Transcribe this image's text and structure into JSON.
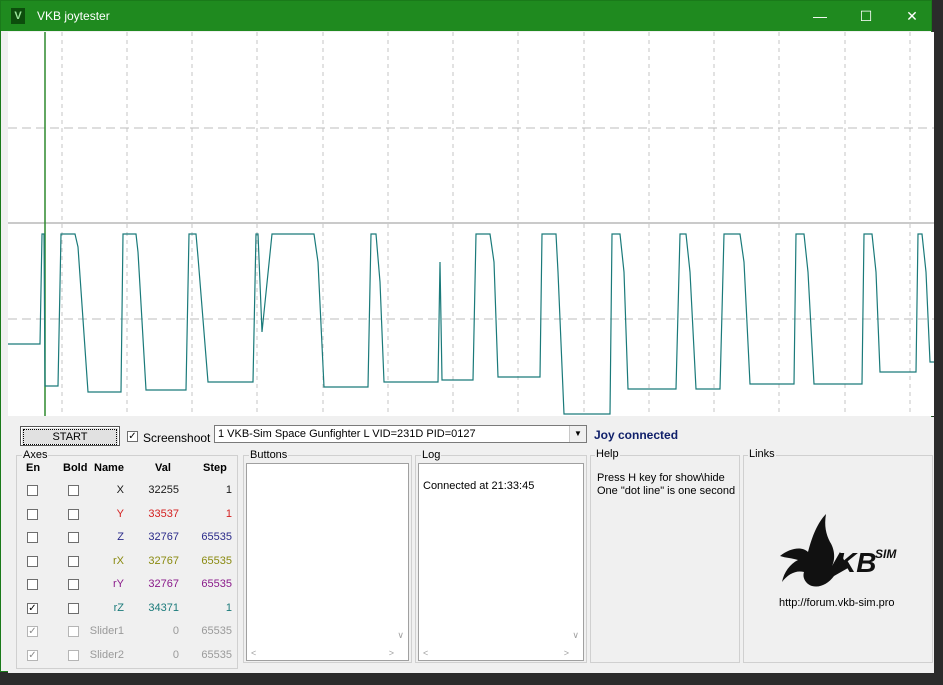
{
  "window": {
    "title": "VKB joytester",
    "minimize": "—",
    "maximize": "☐",
    "close": "✕"
  },
  "toolbar": {
    "start_label": "START",
    "screenshoot_label": "Screenshoot",
    "screenshoot_checked": true,
    "device_selected": "1  VKB-Sim Space Gunfighter L  VID=231D PID=0127",
    "status": "Joy connected"
  },
  "axes": {
    "title": "Axes",
    "headers": {
      "en": "En",
      "bold": "Bold",
      "name": "Name",
      "val": "Val",
      "step": "Step"
    },
    "rows": [
      {
        "name": "X",
        "val": "32255",
        "step": "1",
        "color": "#1a1a1a",
        "en": false,
        "bold": false,
        "disabled": false
      },
      {
        "name": "Y",
        "val": "33537",
        "step": "1",
        "color": "#d42020",
        "en": false,
        "bold": false,
        "disabled": false
      },
      {
        "name": "Z",
        "val": "32767",
        "step": "65535",
        "color": "#2a2a8a",
        "en": false,
        "bold": false,
        "disabled": false
      },
      {
        "name": "rX",
        "val": "32767",
        "step": "65535",
        "color": "#8a8a10",
        "en": false,
        "bold": false,
        "disabled": false
      },
      {
        "name": "rY",
        "val": "32767",
        "step": "65535",
        "color": "#8a1a8a",
        "en": false,
        "bold": false,
        "disabled": false
      },
      {
        "name": "rZ",
        "val": "34371",
        "step": "1",
        "color": "#1a7a7a",
        "en": true,
        "bold": false,
        "disabled": false
      },
      {
        "name": "Slider1",
        "val": "0",
        "step": "65535",
        "color": "#9a9a9a",
        "en": true,
        "bold": false,
        "disabled": true
      },
      {
        "name": "Slider2",
        "val": "0",
        "step": "65535",
        "color": "#9a9a9a",
        "en": true,
        "bold": false,
        "disabled": true
      }
    ]
  },
  "buttons_panel": {
    "title": "Buttons"
  },
  "log": {
    "title": "Log",
    "text": "Connected at 21:33:45"
  },
  "help": {
    "title": "Help",
    "line1": "Press H key for show\\hide",
    "line2": "One \"dot line\" is one second"
  },
  "links": {
    "title": "Links",
    "logo_text": "KB",
    "logo_sup": "SIM",
    "url": "http://forum.vkb-sim.pro"
  },
  "colors": {
    "title_bar": "#1f8a1f",
    "trace": "#1a7a7a",
    "status": "#10206a"
  }
}
